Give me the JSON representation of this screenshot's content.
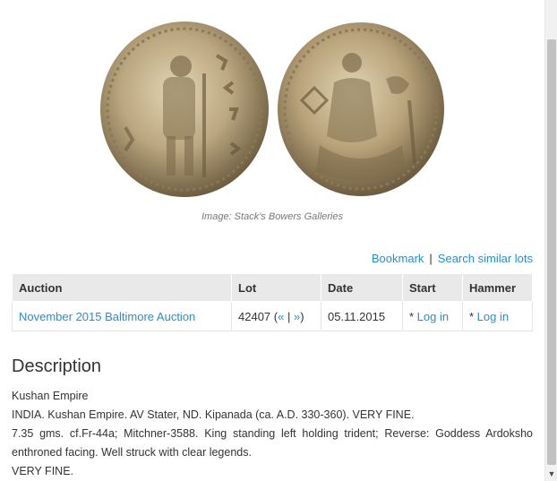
{
  "image": {
    "caption": "Image: Stack's Bowers Galleries",
    "obverse_icon": "coin-obverse",
    "reverse_icon": "coin-reverse"
  },
  "actions": {
    "bookmark": "Bookmark",
    "separator": "|",
    "search_similar": "Search similar lots"
  },
  "table": {
    "headers": [
      "Auction",
      "Lot",
      "Date",
      "Start",
      "Hammer"
    ],
    "row": {
      "auction": "November 2015 Baltimore Auction",
      "lot": "42407",
      "lot_nav_open": "(",
      "lot_prev": "«",
      "lot_nav_sep": " | ",
      "lot_next": "»",
      "lot_nav_close": ")",
      "date": "05.11.2015",
      "start_prefix": "* ",
      "start_link": "Log in",
      "hammer_prefix": "* ",
      "hammer_link": "Log in"
    }
  },
  "description": {
    "title": "Description",
    "lines": [
      "Kushan Empire",
      "INDIA. Kushan Empire. AV Stater, ND. Kipanada (ca. A.D. 330-360). VERY FINE.",
      "7.35 gms. cf.Fr-44a; Mitchner-3588. King standing left holding trident; Reverse: Goddess Ardoksho enthroned facing. Well struck with clear legends.",
      "VERY FINE."
    ]
  },
  "colors": {
    "link": "#2a8ec9",
    "header_bg": "#e9e9e9",
    "coin_gold": "#b8a27a"
  }
}
